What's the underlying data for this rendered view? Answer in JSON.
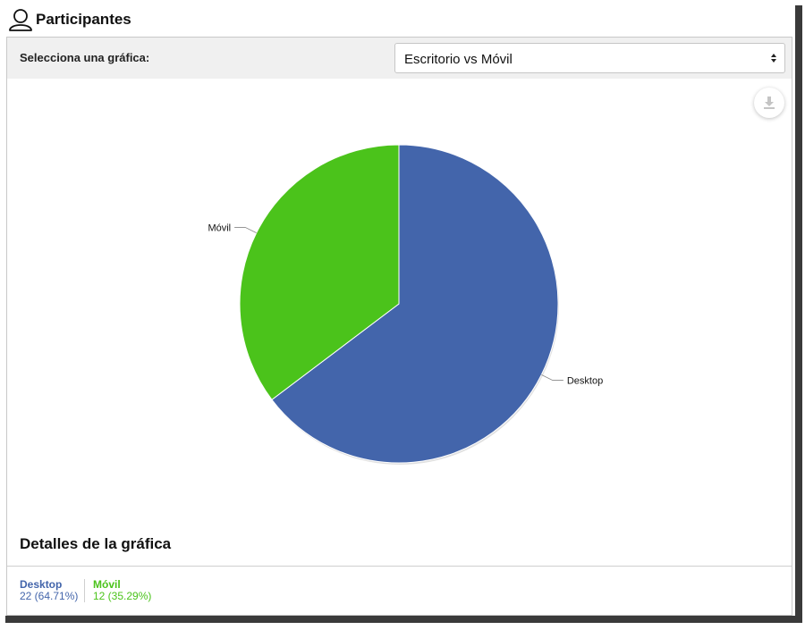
{
  "header": {
    "title": "Participantes"
  },
  "toolbar": {
    "label": "Selecciona una gráfica:",
    "selected": "Escritorio vs Móvil"
  },
  "colors": {
    "desktop": "#4365ab",
    "movil": "#4bc31b"
  },
  "icons": {
    "user": "user-icon",
    "download": "download-icon",
    "select_arrows": "updown-arrows-icon"
  },
  "chart_data": {
    "type": "pie",
    "series": [
      {
        "name": "Desktop",
        "value": 22,
        "percent": 64.71,
        "color": "#4365ab"
      },
      {
        "name": "Móvil",
        "value": 12,
        "percent": 35.29,
        "color": "#4bc31b"
      }
    ],
    "labels": [
      "Desktop",
      "Móvil"
    ]
  },
  "details": {
    "title": "Detalles de la gráfica",
    "items": [
      {
        "name": "Desktop",
        "summary": "22 (64.71%)"
      },
      {
        "name": "Móvil",
        "summary": "12 (35.29%)"
      }
    ]
  }
}
